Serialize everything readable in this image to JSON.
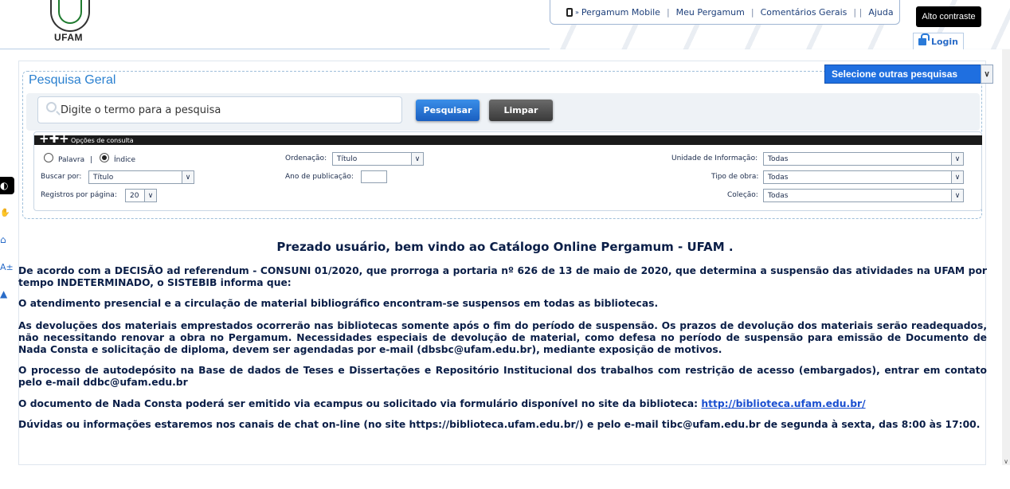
{
  "logo": {
    "text": "UFAM"
  },
  "topmenu": {
    "items": [
      "Pergamum Mobile",
      "Meu Pergamum",
      "Comentários Gerais",
      "Ajuda"
    ]
  },
  "contrast_button": "Alto contraste",
  "login_label": "Login",
  "accessibility_bar": {
    "font_size_label": "A±"
  },
  "search": {
    "section_title": "Pesquisa Geral",
    "select_other": "Selecione outras pesquisas",
    "placeholder": "Digite o termo para a pesquisa",
    "btn_search": "Pesquisar",
    "btn_clear": "Limpar"
  },
  "options": {
    "bar_title": "Opções de consulta",
    "radio_palavra": "Palavra",
    "radio_indice": "Índice",
    "ordenacao_label": "Ordenação:",
    "ordenacao_value": "Título",
    "unidade_label": "Unidade de Informação:",
    "unidade_value": "Todas",
    "buscar_label": "Buscar por:",
    "buscar_value": "Título",
    "ano_label": "Ano de publicação:",
    "tipo_label": "Tipo de obra:",
    "tipo_value": "Todas",
    "registros_label": "Registros por página:",
    "registros_value": "20",
    "colecao_label": "Coleção:",
    "colecao_value": "Todas"
  },
  "welcome": {
    "title": "Prezado usuário, bem vindo ao Catálogo Online Pergamum - UFAM .",
    "p1": "De acordo com a DECISÃO ad referendum - CONSUNI 01/2020, que prorroga a portaria nº 626 de 13 de maio de 2020, que determina a suspensão das atividades na UFAM por tempo INDETERMINADO, o SISTEBIB informa que:",
    "p2": "O atendimento presencial e a circulação de material bibliográfico encontram-se suspensos em todas as bibliotecas.",
    "p3": "As devoluções dos materiais emprestados ocorrerão nas bibliotecas somente após o fim do período de suspensão. Os prazos de devolução dos materiais serão readequados, não necessitando renovar a obra no Pergamum. Necessidades especiais de devolução de material, como defesa no período de suspensão para emissão de Documento de Nada Consta e solicitação de diploma, devem ser agendadas por e-mail (dbsbc@ufam.edu.br), mediante exposição de motivos.",
    "p4": "O processo de autodepósito na Base de dados de Teses e Dissertações e Repositório Institucional dos trabalhos com restrição de acesso (embargados), entrar em contato pelo e-mail ddbc@ufam.edu.br",
    "p5_text": "O documento de Nada Consta poderá ser emitido via ecampus ou solicitado via formulário disponível no site da biblioteca: ",
    "p5_link": "http://biblioteca.ufam.edu.br/",
    "p6": "Dúvidas ou informações estaremos nos canais de chat on-line (no site https://biblioteca.ufam.edu.br/) e pelo e-mail tibc@ufam.edu.br de segunda à sexta, das 8:00 às 17:00."
  }
}
